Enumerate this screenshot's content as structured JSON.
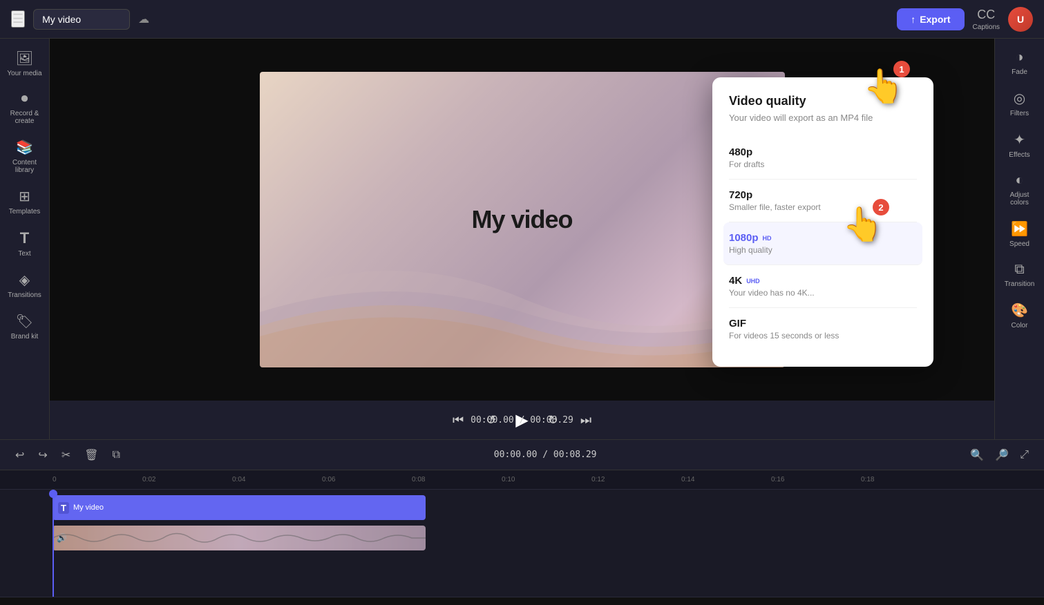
{
  "topbar": {
    "menu_icon": "☰",
    "video_title": "My video",
    "cloud_icon": "☁",
    "export_label": "Export",
    "captions_label": "Captions",
    "avatar_initials": "U"
  },
  "left_sidebar": {
    "items": [
      {
        "id": "your-media",
        "icon": "🖼",
        "label": "Your media"
      },
      {
        "id": "record-create",
        "icon": "⏺",
        "label": "Record & create"
      },
      {
        "id": "content-library",
        "icon": "📚",
        "label": "Content library"
      },
      {
        "id": "templates",
        "icon": "⊞",
        "label": "Templates"
      },
      {
        "id": "text",
        "icon": "T",
        "label": "Text"
      },
      {
        "id": "transitions",
        "icon": "◈",
        "label": "Transitions"
      },
      {
        "id": "brand-kit",
        "icon": "🏷",
        "label": "Brand kit"
      }
    ]
  },
  "right_sidebar": {
    "items": [
      {
        "id": "fade",
        "icon": "◑",
        "label": "Fade"
      },
      {
        "id": "filters",
        "icon": "◎",
        "label": "Filters"
      },
      {
        "id": "effects",
        "icon": "✦",
        "label": "Effects"
      },
      {
        "id": "adjust-colors",
        "icon": "◐",
        "label": "Adjust colors"
      },
      {
        "id": "speed",
        "icon": "⏩",
        "label": "Speed"
      },
      {
        "id": "transition",
        "icon": "⧉",
        "label": "Transition"
      },
      {
        "id": "color",
        "icon": "🎨",
        "label": "Color"
      }
    ]
  },
  "video_preview": {
    "title": "My video"
  },
  "playback": {
    "time_current": "00:00.00",
    "time_total": "00:08.29",
    "time_display": "00:00.00 / 00:08.29"
  },
  "quality_panel": {
    "title": "Video quality",
    "subtitle": "Your video will export as an MP4 file",
    "options": [
      {
        "id": "480p",
        "name": "480p",
        "badge": "",
        "desc": "For drafts",
        "selected": false
      },
      {
        "id": "720p",
        "name": "720p",
        "badge": "",
        "desc": "Smaller file, faster export",
        "selected": false
      },
      {
        "id": "1080p",
        "name": "1080p",
        "badge": "HD",
        "desc": "High quality",
        "selected": true
      },
      {
        "id": "4k",
        "name": "4K",
        "badge": "UHD",
        "desc": "Your video has no 4K...",
        "selected": false
      },
      {
        "id": "gif",
        "name": "GIF",
        "badge": "",
        "desc": "For videos 15 seconds or less",
        "selected": false
      }
    ]
  },
  "timeline": {
    "time_display": "00:00.00 / 00:08.29",
    "ruler_marks": [
      "0:00",
      "0:02",
      "0:04",
      "0:06",
      "0:08",
      "0:10",
      "0:12",
      "0:14",
      "0:16",
      "0:18"
    ],
    "tracks": [
      {
        "id": "video-track",
        "clip_label": "My video"
      },
      {
        "id": "audio-track"
      }
    ]
  },
  "cursors": {
    "badge1": "1",
    "badge2": "2"
  }
}
